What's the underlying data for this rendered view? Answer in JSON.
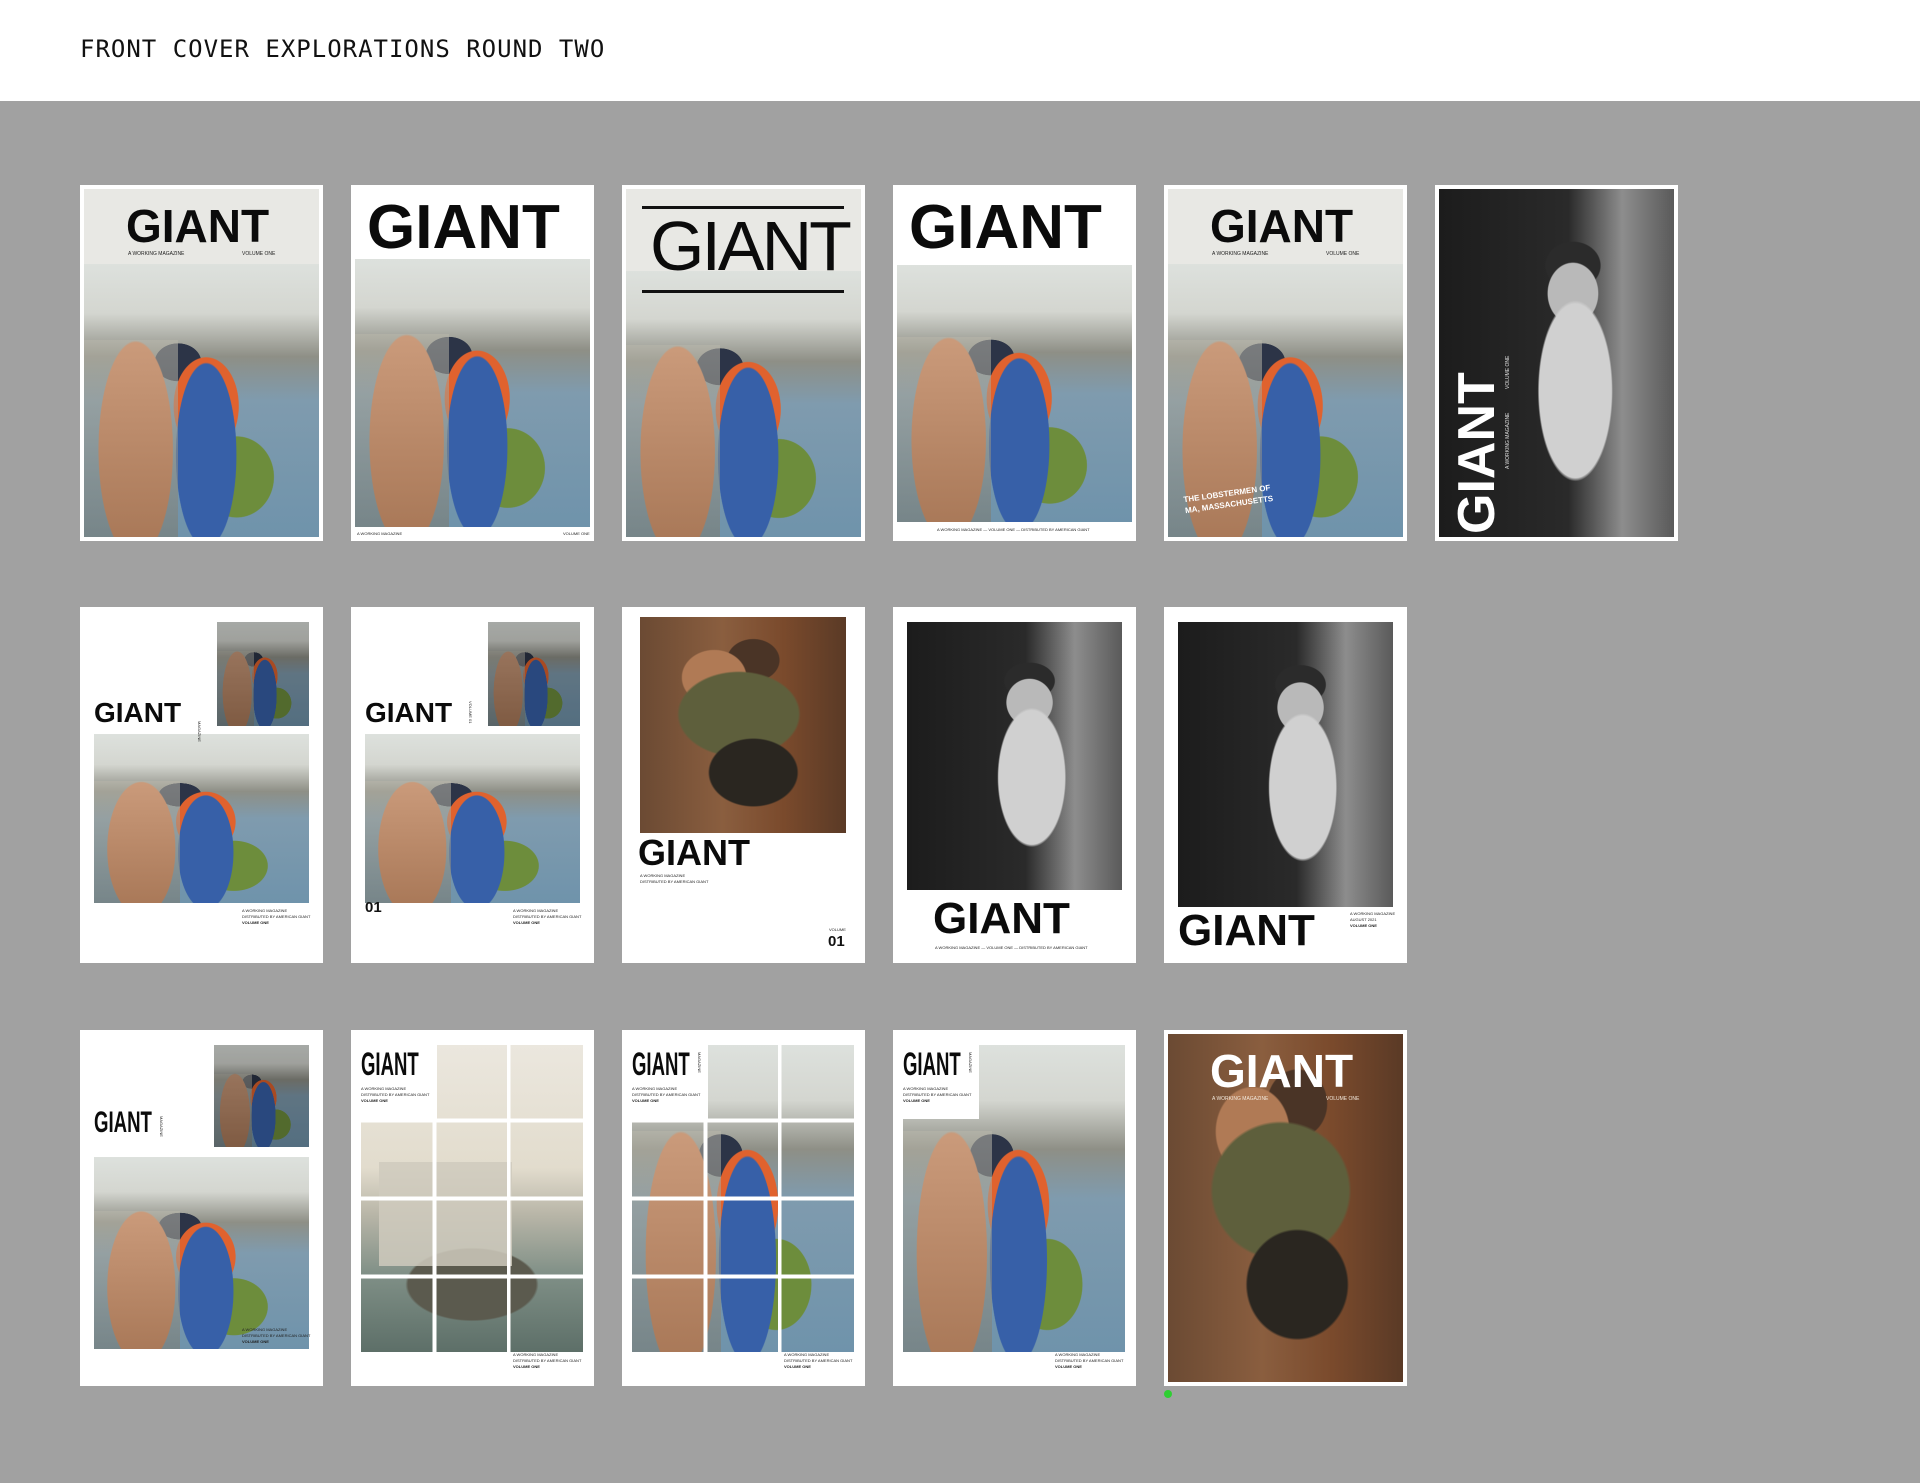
{
  "page": {
    "title": "FRONT COVER EXPLORATIONS ROUND TWO"
  },
  "masthead": "GIANT",
  "labels": {
    "working_magazine": "A WORKING MAGAZINE",
    "working_magazine_upper": "A WORKING MAGAZINE",
    "volume_one": "VOLUME ONE",
    "volume": "VOLUME",
    "distributed": "DISTRIBUTED BY AMERICAN GIANT",
    "footer_line": "A WORKING MAGAZINE — VOLUME ONE — DISTRIBUTED BY AMERICAN GIANT",
    "magazine": "MAGAZINE",
    "volume_01": "VOLUME 01",
    "number_01": "01",
    "august": "AUGUST 2021",
    "lobstermen": "THE LOBSTERMEN OF MA, MASSACHUSETTS"
  },
  "colors": {
    "background": "#a1a1a1",
    "header": "#ffffff",
    "marker": "#2fcf32"
  }
}
